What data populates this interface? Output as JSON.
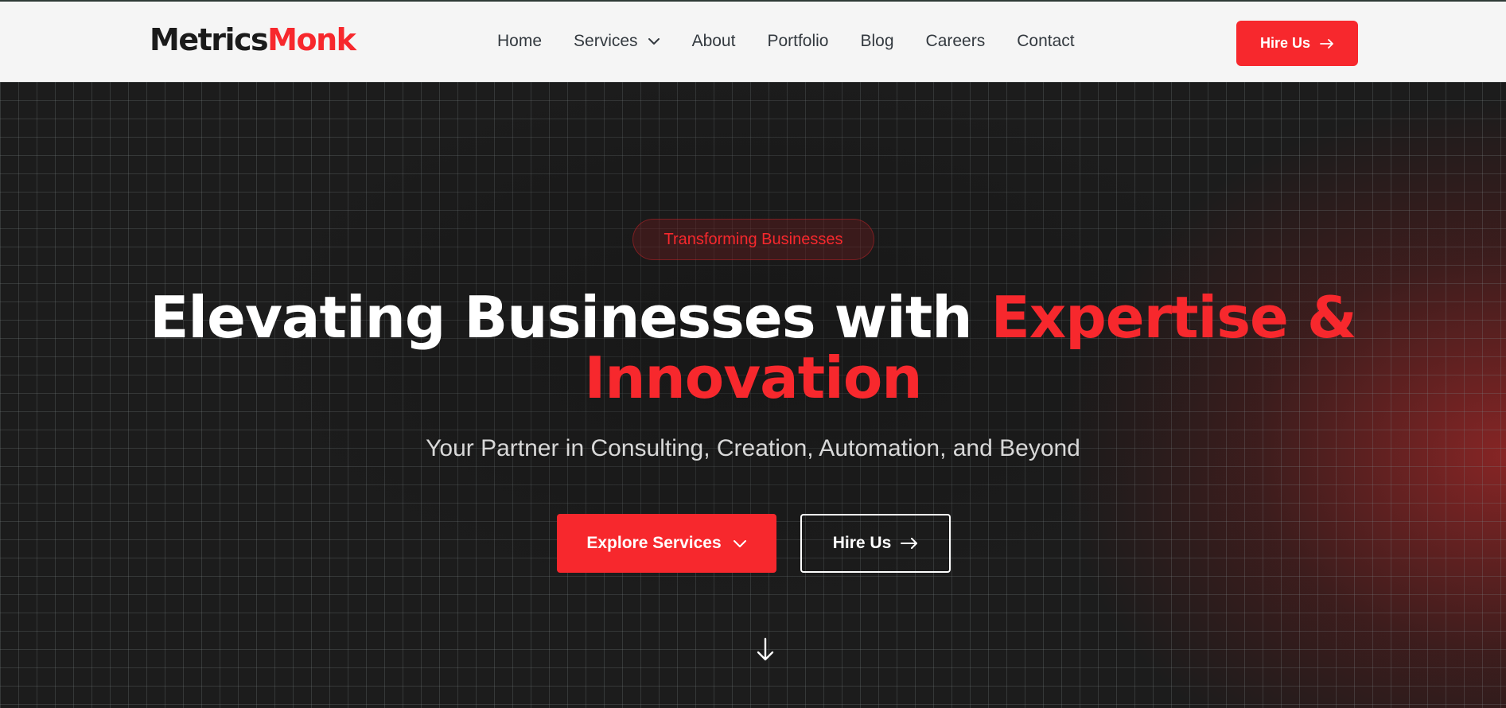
{
  "brand": {
    "part1": "Metrics",
    "part2": "Monk"
  },
  "nav": {
    "items": [
      {
        "label": "Home"
      },
      {
        "label": "Services",
        "has_dropdown": true
      },
      {
        "label": "About"
      },
      {
        "label": "Portfolio"
      },
      {
        "label": "Blog"
      },
      {
        "label": "Careers"
      },
      {
        "label": "Contact"
      }
    ],
    "cta_label": "Hire Us"
  },
  "hero": {
    "badge": "Transforming Businesses",
    "headline_white": "Elevating Businesses with ",
    "headline_red_1": "Expertise &",
    "headline_red_2": "Innovation",
    "subtitle": "Your Partner in Consulting, Creation, Automation, and Beyond",
    "primary_button": "Explore Services",
    "secondary_button": "Hire Us"
  },
  "icons": {
    "dropdown": "chevron-down-icon",
    "cta_arrow": "arrow-right-icon",
    "scroll": "arrow-down-icon"
  },
  "colors": {
    "accent": "#f7282d",
    "header_bg": "#f5f5f5",
    "hero_bg": "#1c1c1c",
    "text_dark": "#1b1b1b",
    "nav_text": "#33393f"
  }
}
